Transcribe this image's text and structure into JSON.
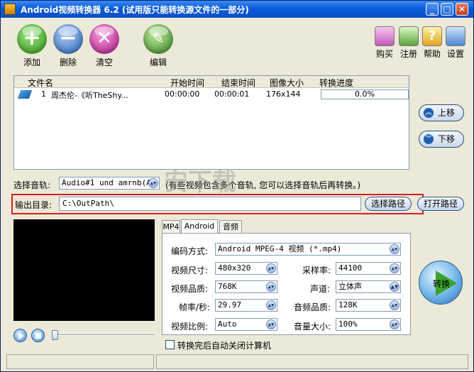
{
  "window": {
    "title": "Android视频转换器 6.2 (试用版只能转换源文件的一部分)"
  },
  "toolbar": {
    "add": "添加",
    "delete": "删除",
    "clear": "清空",
    "edit": "编辑",
    "buy": "购买",
    "register": "注册",
    "help": "帮助",
    "settings": "设置"
  },
  "filelist": {
    "columns": [
      "文件名",
      "开始时间",
      "结束时间",
      "图像大小",
      "转换进度"
    ],
    "rows": [
      {
        "index": "1",
        "name": "周杰伦-《听TheShy...",
        "start": "00:00:00",
        "end": "00:00:01",
        "size": "176x144",
        "progress": "0.0%"
      }
    ]
  },
  "side": {
    "up": "上移",
    "down": "下移"
  },
  "audio": {
    "label": "选择音轨:",
    "value": "Audio#1 und amrnb(Ad",
    "hint": "(有些视频包含多个音轨, 您可以选择音轨后再转换。)"
  },
  "output": {
    "label": "输出目录:",
    "value": "C:\\OutPath\\",
    "choose": "选择路径",
    "open": "打开路径"
  },
  "tabs": [
    "MP4",
    "Android",
    "音频"
  ],
  "settings": {
    "codec_label": "编码方式:",
    "codec_value": "Android MPEG-4 视频 (*.mp4)",
    "size_label": "视频尺寸:",
    "size_value": "480x320",
    "samplerate_label": "采样率:",
    "samplerate_value": "44100",
    "vquality_label": "视频品质:",
    "vquality_value": "768K",
    "channel_label": "声道:",
    "channel_value": "立体声",
    "fps_label": "帧率/秒:",
    "fps_value": "29.97",
    "aquality_label": "音频品质:",
    "aquality_value": "128K",
    "ratio_label": "视频比例:",
    "ratio_value": "Auto",
    "volume_label": "音量大小:",
    "volume_value": "100%"
  },
  "convert_label": "转换",
  "shutdown_label": "转换完后自动关闭计算机",
  "watermark": {
    "main": "安下载",
    "sub": "anxz.com"
  }
}
